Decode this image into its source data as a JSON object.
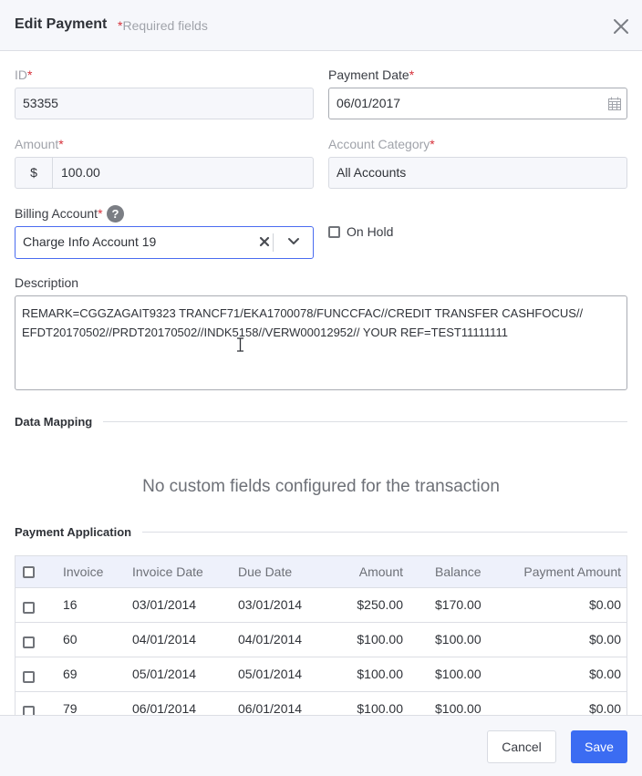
{
  "header": {
    "title": "Edit Payment",
    "required_star": "*",
    "required_note": "Required fields",
    "close_icon": "close-icon"
  },
  "form": {
    "id": {
      "label": "ID",
      "star": "*",
      "value": "53355"
    },
    "payment_date": {
      "label": "Payment Date",
      "star": "*",
      "value": "06/01/2017",
      "icon": "calendar-icon"
    },
    "amount": {
      "label": "Amount",
      "star": "*",
      "prefix": "$",
      "value": "100.00"
    },
    "account_category": {
      "label": "Account Category",
      "star": "*",
      "value": "All Accounts"
    },
    "billing_account": {
      "label": "Billing Account",
      "star": "*",
      "help": "?",
      "value": "Charge Info Account 19"
    },
    "on_hold": {
      "label": "On Hold",
      "checked": false
    },
    "description": {
      "label": "Description",
      "line1": "REMARK=CGGZAGAIT9323 TRANCF71/EKA1700078/FUNCCFAC//CREDIT TRANSFER CASHFOCUS//",
      "line2": "EFDT20170502//PRDT20170502//INDK5158//VERW00012952// YOUR REF=TEST11111111"
    }
  },
  "data_mapping": {
    "title": "Data Mapping",
    "empty_message": "No custom fields configured for the transaction"
  },
  "payment_application": {
    "title": "Payment Application",
    "columns": [
      "Invoice",
      "Invoice Date",
      "Due Date",
      "Amount",
      "Balance",
      "Payment Amount"
    ],
    "rows": [
      {
        "invoice": "16",
        "invoice_date": "03/01/2014",
        "due_date": "03/01/2014",
        "amount": "$250.00",
        "balance": "$170.00",
        "payment_amount": "$0.00"
      },
      {
        "invoice": "60",
        "invoice_date": "04/01/2014",
        "due_date": "04/01/2014",
        "amount": "$100.00",
        "balance": "$100.00",
        "payment_amount": "$0.00"
      },
      {
        "invoice": "69",
        "invoice_date": "05/01/2014",
        "due_date": "05/01/2014",
        "amount": "$100.00",
        "balance": "$100.00",
        "payment_amount": "$0.00"
      },
      {
        "invoice": "79",
        "invoice_date": "06/01/2014",
        "due_date": "06/01/2014",
        "amount": "$100.00",
        "balance": "$100.00",
        "payment_amount": "$0.00"
      }
    ]
  },
  "footer": {
    "cancel_label": "Cancel",
    "save_label": "Save"
  },
  "colors": {
    "accent": "#3b6cf2",
    "required": "#d6303a",
    "header_bg": "#f6f7fb",
    "table_header_bg": "#eef1fb"
  }
}
